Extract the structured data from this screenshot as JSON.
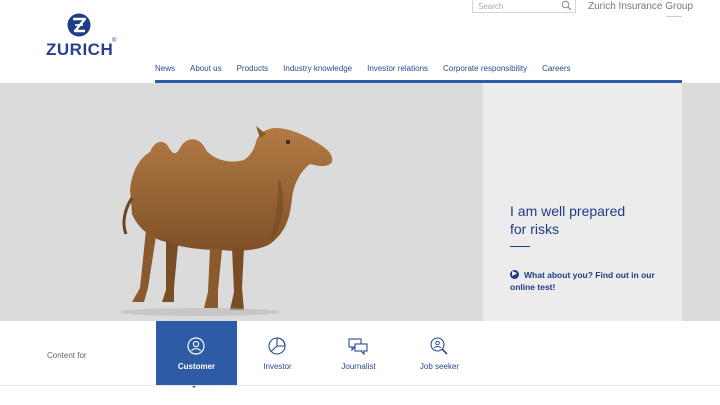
{
  "header": {
    "search_placeholder": "Search",
    "group_link": "Zurich Insurance Group",
    "logo_text": "ZURICH",
    "logo_mark": "Z",
    "logo_registered": "®"
  },
  "nav": {
    "items": [
      "News",
      "About us",
      "Products",
      "Industry knowledge",
      "Investor relations",
      "Corporate responsibility",
      "Careers"
    ]
  },
  "hero": {
    "headline_line1": "I am well prepared",
    "headline_line2": "for risks",
    "cta_text": "What about you? Find out in our online test!",
    "cta_icon": "arrow-right-icon",
    "image": "camel"
  },
  "audience": {
    "label": "Content for",
    "tabs": [
      {
        "label": "Customer",
        "icon": "person-icon",
        "active": true
      },
      {
        "label": "Investor",
        "icon": "pie-chart-icon",
        "active": false
      },
      {
        "label": "Journalist",
        "icon": "speech-bubbles-icon",
        "active": false
      },
      {
        "label": "Job seeker",
        "icon": "magnifier-person-icon",
        "active": false
      }
    ]
  },
  "colors": {
    "brand_blue": "#1f3c88",
    "nav_bar": "#2e5ba6",
    "hero_bg": "#dbdbdb",
    "panel_bg": "#ececec"
  }
}
